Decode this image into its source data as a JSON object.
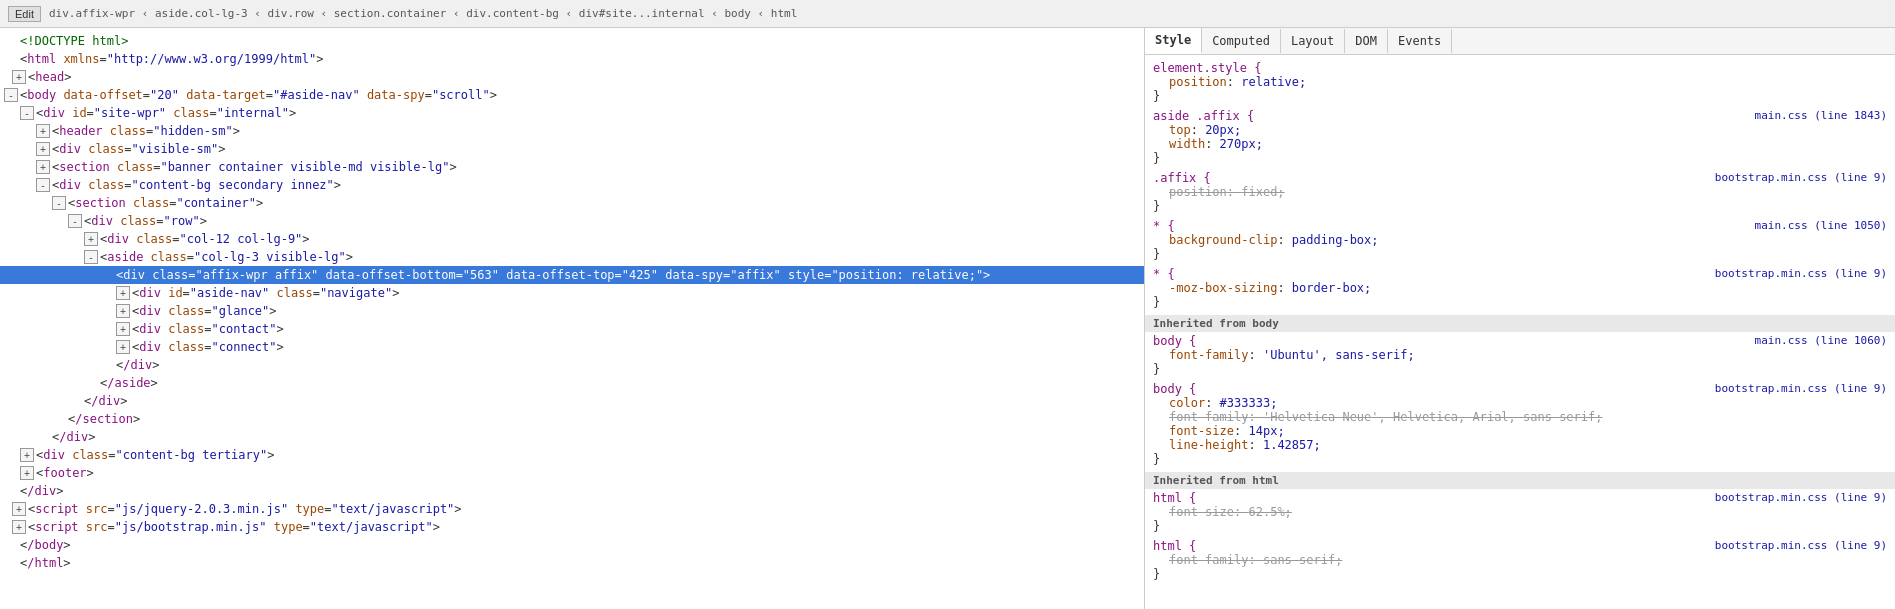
{
  "breadcrumb": {
    "edit_label": "Edit",
    "path": "div.affix-wpr ‹ aside.col-lg-3 ‹ div.row ‹ section.container ‹ div.content-bg ‹ div#site...internal ‹ body ‹ html"
  },
  "tabs": {
    "style": "Style",
    "computed": "Computed",
    "layout": "Layout",
    "dom": "DOM",
    "events": "Events"
  },
  "html_lines": [
    {
      "id": 1,
      "indent": 0,
      "toggle": null,
      "content": "<!DOCTYPE html>",
      "type": "doctype",
      "selected": false
    },
    {
      "id": 2,
      "indent": 0,
      "toggle": null,
      "content": "<html xmlns=\"http://www.w3.org/1999/html\">",
      "type": "tag",
      "selected": false
    },
    {
      "id": 3,
      "indent": 1,
      "toggle": "+",
      "content": "<head>",
      "type": "tag",
      "selected": false
    },
    {
      "id": 4,
      "indent": 0,
      "toggle": "-",
      "content": "<body data-offset=\"20\" data-target=\"#aside-nav\" data-spy=\"scroll\">",
      "type": "tag",
      "selected": false
    },
    {
      "id": 5,
      "indent": 2,
      "toggle": "-",
      "content": "<div id=\"site-wpr\" class=\"internal\">",
      "type": "tag",
      "selected": false
    },
    {
      "id": 6,
      "indent": 4,
      "toggle": "+",
      "content": "<header class=\"hidden-sm\">",
      "type": "tag",
      "selected": false
    },
    {
      "id": 7,
      "indent": 4,
      "toggle": "+",
      "content": "<div class=\"visible-sm\">",
      "type": "tag",
      "selected": false
    },
    {
      "id": 8,
      "indent": 4,
      "toggle": "+",
      "content": "<section class=\"banner container visible-md visible-lg\">",
      "type": "tag",
      "selected": false
    },
    {
      "id": 9,
      "indent": 4,
      "toggle": "-",
      "content": "<div class=\"content-bg secondary innez\">",
      "type": "tag",
      "selected": false
    },
    {
      "id": 10,
      "indent": 6,
      "toggle": "-",
      "content": "<section class=\"container\">",
      "type": "tag",
      "selected": false
    },
    {
      "id": 11,
      "indent": 8,
      "toggle": "-",
      "content": "<div class=\"row\">",
      "type": "tag",
      "selected": false
    },
    {
      "id": 12,
      "indent": 10,
      "toggle": "+",
      "content": "<div class=\"col-12 col-lg-9\">",
      "type": "tag",
      "selected": false
    },
    {
      "id": 13,
      "indent": 10,
      "toggle": "-",
      "content": "<aside class=\"col-lg-3 visible-lg\">",
      "type": "tag",
      "selected": false
    },
    {
      "id": 14,
      "indent": 12,
      "toggle": null,
      "content": "<div class=\"affix-wpr affix\" data-offset-bottom=\"563\" data-offset-top=\"425\" data-spy=\"affix\" style=\"position: relative;\">",
      "type": "tag",
      "selected": true
    },
    {
      "id": 15,
      "indent": 14,
      "toggle": "+",
      "content": "<div id=\"aside-nav\" class=\"navigate\">",
      "type": "tag",
      "selected": false
    },
    {
      "id": 16,
      "indent": 14,
      "toggle": "+",
      "content": "<div class=\"glance\">",
      "type": "tag",
      "selected": false
    },
    {
      "id": 17,
      "indent": 14,
      "toggle": "+",
      "content": "<div class=\"contact\">",
      "type": "tag",
      "selected": false
    },
    {
      "id": 18,
      "indent": 14,
      "toggle": "+",
      "content": "<div class=\"connect\">",
      "type": "tag",
      "selected": false
    },
    {
      "id": 19,
      "indent": 12,
      "toggle": null,
      "content": "</div>",
      "type": "tag",
      "selected": false
    },
    {
      "id": 20,
      "indent": 10,
      "toggle": null,
      "content": "</aside>",
      "type": "tag",
      "selected": false
    },
    {
      "id": 21,
      "indent": 8,
      "toggle": null,
      "content": "</div>",
      "type": "tag",
      "selected": false
    },
    {
      "id": 22,
      "indent": 6,
      "toggle": null,
      "content": "</section>",
      "type": "tag",
      "selected": false
    },
    {
      "id": 23,
      "indent": 4,
      "toggle": null,
      "content": "</div>",
      "type": "tag",
      "selected": false
    },
    {
      "id": 24,
      "indent": 2,
      "toggle": "+",
      "content": "<div class=\"content-bg tertiary\">",
      "type": "tag",
      "selected": false
    },
    {
      "id": 25,
      "indent": 2,
      "toggle": "+",
      "content": "<footer>",
      "type": "tag",
      "selected": false
    },
    {
      "id": 26,
      "indent": 0,
      "toggle": null,
      "content": "</div>",
      "type": "tag",
      "selected": false
    },
    {
      "id": 27,
      "indent": 1,
      "toggle": "+",
      "content": "<script src=\"js/jquery-2.0.3.min.js\" type=\"text/javascript\">",
      "type": "tag",
      "selected": false
    },
    {
      "id": 28,
      "indent": 1,
      "toggle": "+",
      "content": "<script src=\"js/bootstrap.min.js\" type=\"text/javascript\">",
      "type": "tag",
      "selected": false
    },
    {
      "id": 29,
      "indent": 0,
      "toggle": null,
      "content": "</body>",
      "type": "tag",
      "selected": false
    },
    {
      "id": 30,
      "indent": 0,
      "toggle": null,
      "content": "</html>",
      "type": "tag",
      "selected": false
    }
  ],
  "css_rules": [
    {
      "selector": "element.style {",
      "source": "",
      "props": [
        {
          "name": "position",
          "value": "relative;",
          "strikethrough": false
        }
      ],
      "close": "}"
    },
    {
      "selector": "aside .affix {",
      "source": "main.css (line 1843)",
      "props": [
        {
          "name": "top",
          "value": "20px;",
          "strikethrough": false
        },
        {
          "name": "width",
          "value": "270px;",
          "strikethrough": false
        }
      ],
      "close": "}"
    },
    {
      "selector": ".affix {",
      "source": "bootstrap.min.css (line 9)",
      "props": [
        {
          "name": "position",
          "value": "fixed;",
          "strikethrough": true
        }
      ],
      "close": "}"
    },
    {
      "selector": "* {",
      "source": "main.css (line 1050)",
      "props": [
        {
          "name": "background-clip",
          "value": "padding-box;",
          "strikethrough": false
        }
      ],
      "close": "}"
    },
    {
      "selector": "* {",
      "source": "bootstrap.min.css (line 9)",
      "props": [
        {
          "name": "-moz-box-sizing",
          "value": "border-box;",
          "strikethrough": false
        }
      ],
      "close": "}"
    }
  ],
  "css_inherited_body": {
    "header": "Inherited from body",
    "rules": [
      {
        "selector": "body {",
        "source": "main.css (line 1060)",
        "props": [
          {
            "name": "font-family",
            "value": "'Ubuntu', sans-serif;",
            "strikethrough": false
          }
        ],
        "close": "}"
      },
      {
        "selector": "body {",
        "source": "bootstrap.min.css (line 9)",
        "props": [
          {
            "name": "color",
            "value": "#333333;",
            "strikethrough": false
          },
          {
            "name": "font-family",
            "value": "'Helvetica Neue', Helvetica, Arial, sans-serif;",
            "strikethrough": true
          },
          {
            "name": "font-size",
            "value": "14px;",
            "strikethrough": false
          },
          {
            "name": "line-height",
            "value": "1.42857;",
            "strikethrough": false
          }
        ],
        "close": "}"
      }
    ]
  },
  "css_inherited_html": {
    "header": "Inherited from html",
    "rules": [
      {
        "selector": "html {",
        "source": "bootstrap.min.css (line 9)",
        "props": [
          {
            "name": "font-size",
            "value": "62.5%;",
            "strikethrough": true
          }
        ],
        "close": "}"
      },
      {
        "selector": "html {",
        "source": "bootstrap.min.css (line 9)",
        "props": [
          {
            "name": "font-family",
            "value": "sans-serif;",
            "strikethrough": true
          }
        ],
        "close": "}"
      }
    ]
  }
}
